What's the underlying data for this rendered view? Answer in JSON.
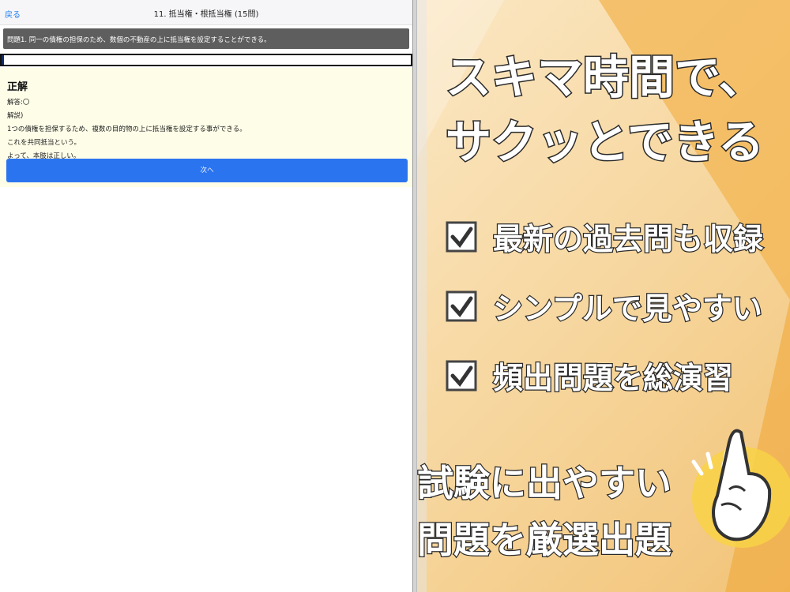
{
  "nav": {
    "back_label": "戻る",
    "title": "11. 抵当権・根抵当権 (15問)"
  },
  "question": {
    "text": "問題1. 同一の債権の担保のため、数個の不動産の上に抵当権を設定することができる。"
  },
  "progress": {
    "fraction": 0.0067
  },
  "answer": {
    "result": "正解",
    "answer_line": "解答:〇",
    "explanation_label": "解説)",
    "lines": [
      "1つの債権を担保するため、複数の目的物の上に抵当権を設定する事ができる。",
      "これを共同抵当という。",
      "よって、本肢は正しい。"
    ]
  },
  "next_button": {
    "label": "次へ"
  },
  "promo": {
    "headline_1": "スキマ時間で、",
    "headline_2": "サクッとできる",
    "features": [
      "最新の過去問も収録",
      "シンプルで見やすい",
      "頻出問題を総演習"
    ],
    "footer_1": "試験に出やすい",
    "footer_2": "問題を厳選出題",
    "colors": {
      "background": "#f6d59b",
      "accent": "#f0a83a",
      "text": "#ffffff",
      "outline": "#2a2a2a"
    }
  }
}
